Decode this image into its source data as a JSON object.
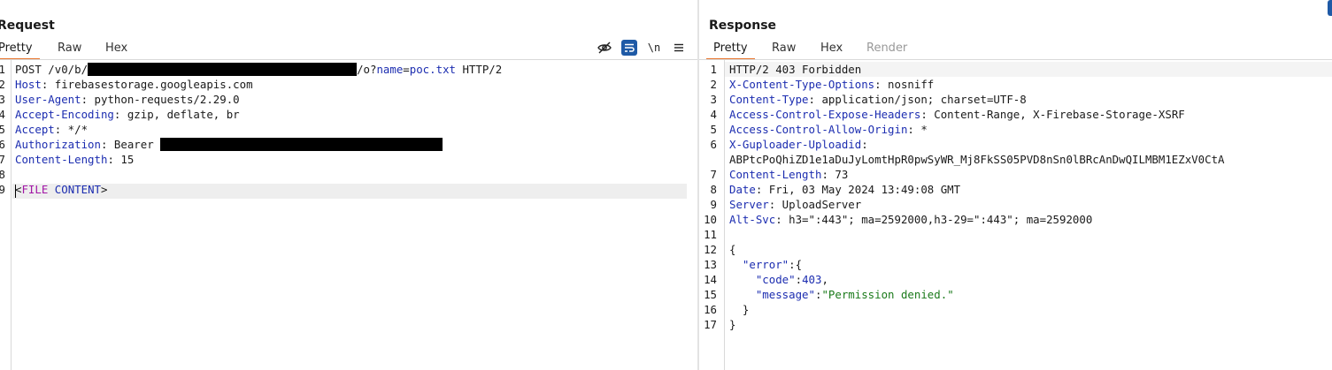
{
  "request": {
    "title": "Request",
    "tabs": [
      "Pretty",
      "Raw",
      "Hex"
    ],
    "active_tab": "Pretty",
    "toolbar": {
      "hide_icon": "eye-slash-icon",
      "wrap_icon": "wrap-lines-icon",
      "newline_label": "\\n",
      "menu_icon": "hamburger-menu-icon"
    },
    "lines": [
      {
        "n": "1",
        "segs": [
          {
            "t": "POST /v0/b/"
          },
          {
            "redact": true
          },
          {
            "t": "/o?"
          },
          {
            "t": "name",
            "c": "hn"
          },
          {
            "t": "="
          },
          {
            "t": "poc.txt",
            "c": "hn"
          },
          {
            "t": " HTTP/2"
          }
        ]
      },
      {
        "n": "2",
        "segs": [
          {
            "t": "Host",
            "c": "hn"
          },
          {
            "t": ": firebasestorage.googleapis.com"
          }
        ]
      },
      {
        "n": "3",
        "segs": [
          {
            "t": "User-Agent",
            "c": "hn"
          },
          {
            "t": ": python-requests/2.29.0"
          }
        ]
      },
      {
        "n": "4",
        "segs": [
          {
            "t": "Accept-Encoding",
            "c": "hn"
          },
          {
            "t": ": gzip, deflate, br"
          }
        ]
      },
      {
        "n": "5",
        "segs": [
          {
            "t": "Accept",
            "c": "hn"
          },
          {
            "t": ": */*"
          }
        ]
      },
      {
        "n": "6",
        "segs": [
          {
            "t": "Authorization",
            "c": "hn"
          },
          {
            "t": ": Bearer "
          },
          {
            "redact": true
          }
        ]
      },
      {
        "n": "7",
        "segs": [
          {
            "t": "Content-Length",
            "c": "hn"
          },
          {
            "t": ": 15"
          }
        ]
      },
      {
        "n": "8",
        "segs": []
      },
      {
        "n": "9",
        "segs": [
          {
            "t": "<"
          },
          {
            "t": "FILE",
            "c": "tag"
          },
          {
            "t": " "
          },
          {
            "t": "CONTENT",
            "c": "hn"
          },
          {
            "t": ">"
          }
        ]
      }
    ]
  },
  "response": {
    "title": "Response",
    "tabs": [
      "Pretty",
      "Raw",
      "Hex",
      "Render"
    ],
    "active_tab": "Pretty",
    "lines": [
      {
        "n": "1",
        "segs": [
          {
            "t": "HTTP/2 403 Forbidden"
          }
        ]
      },
      {
        "n": "2",
        "segs": [
          {
            "t": "X-Content-Type-Options",
            "c": "hn"
          },
          {
            "t": ": nosniff"
          }
        ]
      },
      {
        "n": "3",
        "segs": [
          {
            "t": "Content-Type",
            "c": "hn"
          },
          {
            "t": ": application/json; charset=UTF-8"
          }
        ]
      },
      {
        "n": "4",
        "segs": [
          {
            "t": "Access-Control-Expose-Headers",
            "c": "hn"
          },
          {
            "t": ": Content-Range, X-Firebase-Storage-XSRF"
          }
        ]
      },
      {
        "n": "5",
        "segs": [
          {
            "t": "Access-Control-Allow-Origin",
            "c": "hn"
          },
          {
            "t": ": *"
          }
        ]
      },
      {
        "n": "6",
        "segs": [
          {
            "t": "X-Guploader-Uploadid",
            "c": "hn"
          },
          {
            "t": ":"
          }
        ]
      },
      {
        "n": "",
        "segs": [
          {
            "t": "ABPtcPoQhiZD1e1aDuJyLomtHpR0pwSyWR_Mj8FkSS05PVD8nSn0lBRcAnDwQILMBM1EZxV0CtA"
          }
        ]
      },
      {
        "n": "7",
        "segs": [
          {
            "t": "Content-Length",
            "c": "hn"
          },
          {
            "t": ": 73"
          }
        ]
      },
      {
        "n": "8",
        "segs": [
          {
            "t": "Date",
            "c": "hn"
          },
          {
            "t": ": Fri, 03 May 2024 13:49:08 GMT"
          }
        ]
      },
      {
        "n": "9",
        "segs": [
          {
            "t": "Server",
            "c": "hn"
          },
          {
            "t": ": UploadServer"
          }
        ]
      },
      {
        "n": "10",
        "segs": [
          {
            "t": "Alt-Svc",
            "c": "hn"
          },
          {
            "t": ": h3=\":443\"; ma=2592000,h3-29=\":443\"; ma=2592000"
          }
        ]
      },
      {
        "n": "11",
        "segs": []
      },
      {
        "n": "12",
        "segs": [
          {
            "t": "{"
          }
        ]
      },
      {
        "n": "13",
        "segs": [
          {
            "t": "  "
          },
          {
            "t": "\"error\"",
            "c": "hn"
          },
          {
            "t": ":{"
          }
        ]
      },
      {
        "n": "14",
        "segs": [
          {
            "t": "    "
          },
          {
            "t": "\"code\"",
            "c": "hn"
          },
          {
            "t": ":"
          },
          {
            "t": "403",
            "c": "num"
          },
          {
            "t": ","
          }
        ]
      },
      {
        "n": "15",
        "segs": [
          {
            "t": "    "
          },
          {
            "t": "\"message\"",
            "c": "hn"
          },
          {
            "t": ":"
          },
          {
            "t": "\"Permission denied.\"",
            "c": "str"
          }
        ]
      },
      {
        "n": "16",
        "segs": [
          {
            "t": "  }"
          }
        ]
      },
      {
        "n": "17",
        "segs": [
          {
            "t": "}"
          }
        ]
      }
    ]
  },
  "colors": {
    "accent_tab": "#e8742b",
    "header_name": "#1c2db0",
    "string": "#1a7a1a",
    "tag": "#a216a6",
    "wrap_button": "#1f5aa6"
  }
}
